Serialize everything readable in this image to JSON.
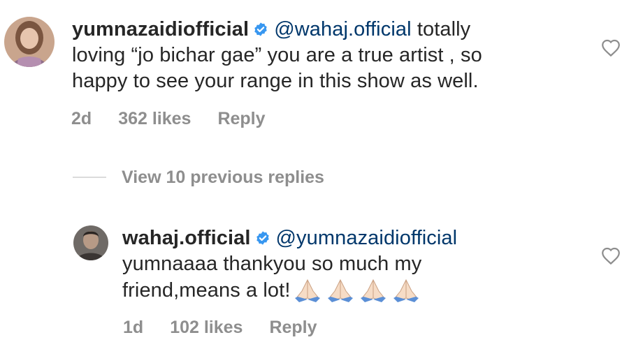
{
  "comments": [
    {
      "username": "yumnazaidiofficial",
      "mention": "@wahaj.official",
      "text_line1": "totally",
      "text_line2": "loving “jo bichar gae” you are a true artist , so",
      "text_line3": "happy to see your range in this show as well.",
      "time": "2d",
      "likes": "362 likes",
      "reply_label": "Reply"
    },
    {
      "username": "wahaj.official",
      "mention": "@yumnazaidiofficial",
      "text_line1": "yumnaaaa thankyou so much my",
      "text_line2": "friend,means a lot!",
      "emoji": "🙏🏻🙏🏻🙏🏻🙏🏻",
      "time": "1d",
      "likes": "102 likes",
      "reply_label": "Reply"
    }
  ],
  "view_replies": {
    "label": "View 10 previous replies"
  },
  "icons": {
    "verified": "verified-badge-icon",
    "like": "heart-outline-icon",
    "emoji": "folded-hands-emoji"
  },
  "colors": {
    "text": "#262626",
    "mention": "#00376b",
    "meta": "#8e8e8e",
    "verified": "#3897f0",
    "divider": "#dbdbdb"
  }
}
